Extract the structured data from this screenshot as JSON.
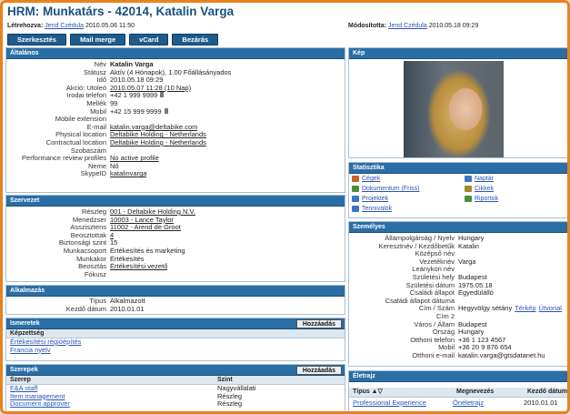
{
  "header": {
    "title": "HRM: Munkatárs - 42014, Katalin Varga",
    "created_label": "Létrehozva:",
    "created_by": "Jend Czédula",
    "created_at": "2010.05.06 11:50",
    "modified_label": "Módosította:",
    "modified_by": "Jend Czédula",
    "modified_at": "2010.05.18 09:29"
  },
  "toolbar": {
    "edit": "Szerkesztés",
    "mail_merge": "Mail merge",
    "vcard": "vCard",
    "close": "Bezárás"
  },
  "general": {
    "title": "Általános",
    "rows": [
      {
        "label": "Név",
        "value": "Katalin Varga",
        "bold": true
      },
      {
        "label": "Státusz",
        "value": "Aktív (4 Hónapok), 1.00 Főállásányados"
      },
      {
        "label": "Idő",
        "value": "2010.05.18 09:29"
      },
      {
        "label": "Akció: Utoleó",
        "value": "2010.05.07 11:28 (10 Nap)",
        "link": true
      },
      {
        "label": "Irodai telefon",
        "value": "+42 1 999 9999",
        "phone": true
      },
      {
        "label": "Mellék",
        "value": "99"
      },
      {
        "label": "Mobil",
        "value": "+42 15 999 9999",
        "phone": true
      },
      {
        "label": "Mobile extension",
        "value": ""
      },
      {
        "label": "E-mail",
        "value": "katalin.varga@deltabike.com",
        "link": true
      },
      {
        "label": "Physical location",
        "value": "Deltabike Holding - Netherlands",
        "link": true
      },
      {
        "label": "Contractual location",
        "value": "Deltabike Holding - Netherlands",
        "link": true
      },
      {
        "label": "Szobaszám",
        "value": ""
      },
      {
        "label": "Performance review profiles",
        "value": "No active profile",
        "link": true
      },
      {
        "label": "Neme",
        "value": "Nő"
      },
      {
        "label": "SkypeID",
        "value": "katalinvarga",
        "link": true
      }
    ]
  },
  "org": {
    "title": "Szervezet",
    "rows": [
      {
        "label": "Részleg",
        "value": "001 - Deltabike Holding N.V.",
        "link": true
      },
      {
        "label": "Menedzser",
        "value": "10003 - Lance Taylor",
        "link": true
      },
      {
        "label": "Asszisztens",
        "value": "11002 - Arend de Groot",
        "link": true
      },
      {
        "label": "Beosztottak",
        "value": "4",
        "link": true
      },
      {
        "label": "Biztonsági szint",
        "value": "15"
      },
      {
        "label": "Munkacsoport",
        "value": "Értékesítés és marketing"
      },
      {
        "label": "Munkakor",
        "value": "Értékesítés"
      },
      {
        "label": "Beosztás",
        "value": "Értékesítési vezető",
        "link": true
      },
      {
        "label": "Fókusz",
        "value": ""
      }
    ]
  },
  "employment": {
    "title": "Alkalmazás",
    "rows": [
      {
        "label": "Típus",
        "value": "Alkalmazott"
      },
      {
        "label": "Kezdő dátum",
        "value": "2010.01.01"
      }
    ]
  },
  "knowledge": {
    "title": "Ismeretek",
    "add": "Hozzáadás",
    "sub": "Képzettség",
    "items": [
      "Értékesítési régióépítés",
      "Francia nyelv"
    ]
  },
  "roles": {
    "title": "Szerepek",
    "add": "Hozzáadás",
    "col_role": "Szerep",
    "col_level": "Szint",
    "rows": [
      {
        "role": "F&A staff",
        "level": "Nagyvállalati"
      },
      {
        "role": "Item management",
        "level": "Részleg"
      },
      {
        "role": "Document approver",
        "level": "Részleg"
      }
    ]
  },
  "picture": {
    "title": "Kép"
  },
  "stats": {
    "title": "Statisztika",
    "items": [
      {
        "label": "Cégek",
        "color": "#c9642a"
      },
      {
        "label": "Naptár",
        "color": "#3b78c4"
      },
      {
        "label": "Dokumentum (Friss)",
        "color": "#4a8f3a"
      },
      {
        "label": "Cikkek",
        "color": "#a08a2c"
      },
      {
        "label": "Projektek",
        "color": "#3b78c4"
      },
      {
        "label": "Riportok",
        "color": "#4a8f3a"
      },
      {
        "label": "Tennivalók",
        "color": "#3b78c4"
      }
    ]
  },
  "personal": {
    "title": "Személyes",
    "rows": [
      {
        "label": "Állampolgárság / Nyelv",
        "value": "Hungary"
      },
      {
        "label": "Keresztnév / Kezdőbetűk",
        "value": "Katalin"
      },
      {
        "label": "Középső név",
        "value": ""
      },
      {
        "label": "Vezetéknév",
        "value": "Varga"
      },
      {
        "label": "Leánykori név",
        "value": ""
      },
      {
        "label": "Születési hely",
        "value": "Budapest"
      },
      {
        "label": "Születési dátum",
        "value": "1975.05.18"
      },
      {
        "label": "Családi állapot",
        "value": "Egyedülálló"
      },
      {
        "label": "Családi állapot dátuma",
        "value": ""
      },
      {
        "label": "Cím / Szám",
        "value": "Hegyvölgy sétány",
        "extra1": "Térkép",
        "extra2": "Útvonal"
      },
      {
        "label": "Cím 2",
        "value": ""
      },
      {
        "label": "Város / Állam",
        "value": "Budapest"
      },
      {
        "label": "Ország",
        "value": "Hungary"
      },
      {
        "label": "Otthoni telefon",
        "value": "+36 1 123 4567"
      },
      {
        "label": "Mobil",
        "value": "+36 20 9 876 654"
      },
      {
        "label": "Otthoni e-mail",
        "value": "katalin.varga@gtsdatanet.hu"
      }
    ]
  },
  "cv": {
    "title": "Életrajz",
    "col_type": "Típus",
    "sort_icons": "▲▽",
    "col_name": "Megnevezés",
    "col_start": "Kezdő dátum",
    "rows": [
      {
        "type": "Professional Experience",
        "name": "Önéletrajz",
        "start": "2010.01.01"
      }
    ]
  }
}
